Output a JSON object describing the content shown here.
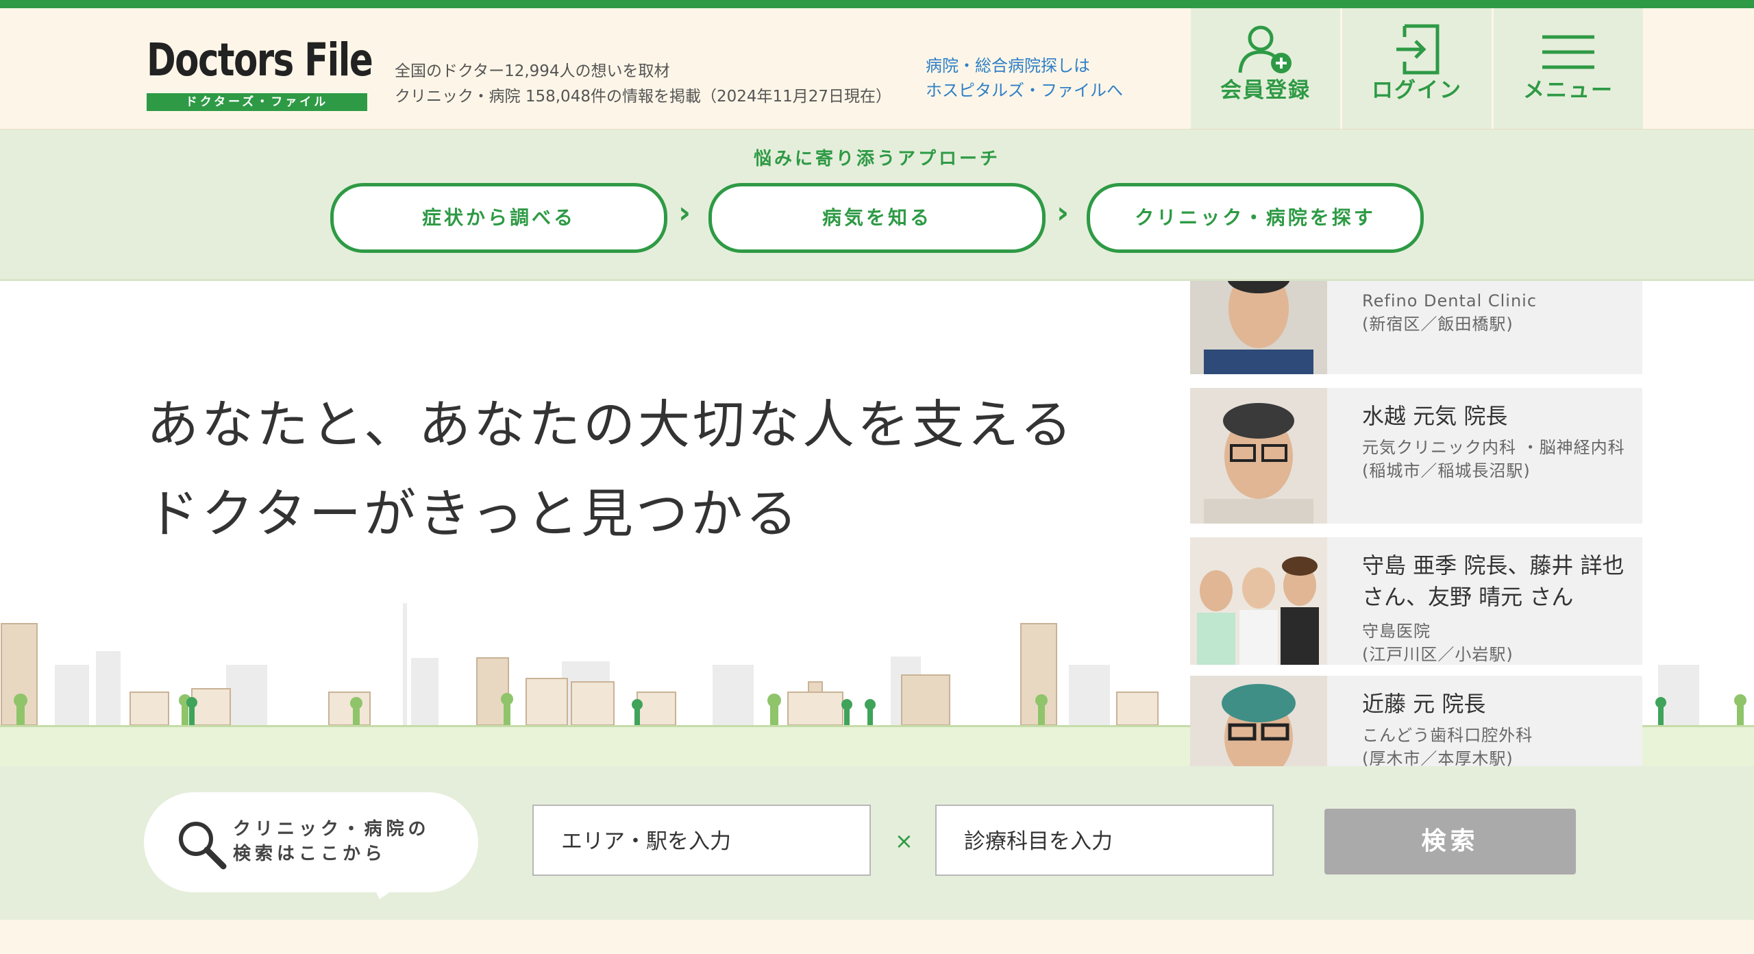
{
  "header": {
    "logo_text": "Doctors File",
    "logo_sub": "ドクターズ・ファイル",
    "info_line1": "全国のドクター12,994人の想いを取材",
    "info_line2": "クリニック・病院 158,048件の情報を掲載（2024年11月27日現在）",
    "hospital_link_line1": "病院・総合病院探しは",
    "hospital_link_line2": "ホスピタルズ・ファイルへ",
    "register_label": "会員登録",
    "login_label": "ログイン",
    "menu_label": "メニュー"
  },
  "approach": {
    "title": "悩みに寄り添うアプローチ",
    "steps": [
      "症状から調べる",
      "病気を知る",
      "クリニック・病院を探す"
    ]
  },
  "hero": {
    "line1": "あなたと、あなたの大切な人を支える",
    "line2": "ドクターがきっと見つかる"
  },
  "doctors": [
    {
      "name": "",
      "clinic": "Refino Dental Clinic",
      "location": "(新宿区／飯田橋駅)"
    },
    {
      "name": "水越 元気 院長",
      "clinic": "元気クリニック内科 ・脳神経内科",
      "location": "(稲城市／稲城長沼駅)"
    },
    {
      "name_line1": "守島 亜季 院長、藤井 詳也",
      "name_line2": "さん、友野 晴元 さん",
      "clinic": "守島医院",
      "location": "(江戸川区／小岩駅)"
    },
    {
      "name": "近藤 元 院長",
      "clinic": "こんどう歯科口腔外科",
      "location": "(厚木市／本厚木駅)"
    }
  ],
  "search": {
    "bubble_line1": "クリニック・病院の",
    "bubble_line2": "検索はここから",
    "area_placeholder": "エリア・駅を入力",
    "times_symbol": "×",
    "dept_placeholder": "診療科目を入力",
    "button_label": "検索"
  },
  "colors": {
    "brand_green": "#2e9a45",
    "link_blue": "#2f7fc5",
    "bg_cream": "#fdf6e8",
    "bg_green": "#e5eedb"
  },
  "icons": [
    "user-plus-icon",
    "login-icon",
    "hamburger-menu-icon",
    "search-magnifier-icon",
    "chevron-right-icon"
  ]
}
